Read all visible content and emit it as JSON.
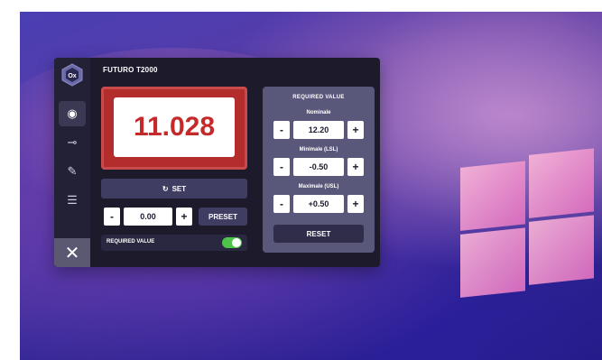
{
  "app": {
    "title": "FUTURO T2000",
    "logo_label": "Ox",
    "logo_icon": "hexagon-logo-icon",
    "close_icon": "close-icon"
  },
  "sidebar": {
    "items": [
      {
        "name": "target",
        "icon": "crosshair-icon",
        "active": true
      },
      {
        "name": "probe",
        "icon": "probe-icon",
        "active": false
      },
      {
        "name": "tools",
        "icon": "wrench-icon",
        "active": false
      },
      {
        "name": "settings",
        "icon": "sliders-icon",
        "active": false
      }
    ]
  },
  "display": {
    "value": "11.028",
    "frame_color": "#b32d2d",
    "text_color": "#c42a2a"
  },
  "set_button": {
    "label": "SET",
    "icon": "refresh-icon"
  },
  "preset": {
    "minus": "-",
    "plus": "+",
    "value": "0.00",
    "button_label": "PRESET"
  },
  "required_toggle": {
    "label": "REQUIRED VALUE",
    "on": true,
    "color": "#4fc24b"
  },
  "required_panel": {
    "title": "REQUIRED VALUE",
    "fields": [
      {
        "label": "Nominale",
        "value": "12.20",
        "minus": "-",
        "plus": "+"
      },
      {
        "label": "Minimale (LSL)",
        "value": "-0.50",
        "minus": "-",
        "plus": "+"
      },
      {
        "label": "Maximale (USL)",
        "value": "+0.50",
        "minus": "-",
        "plus": "+"
      }
    ],
    "reset_label": "RESET"
  },
  "desktop": {
    "os_logo": "windows-logo-icon"
  }
}
